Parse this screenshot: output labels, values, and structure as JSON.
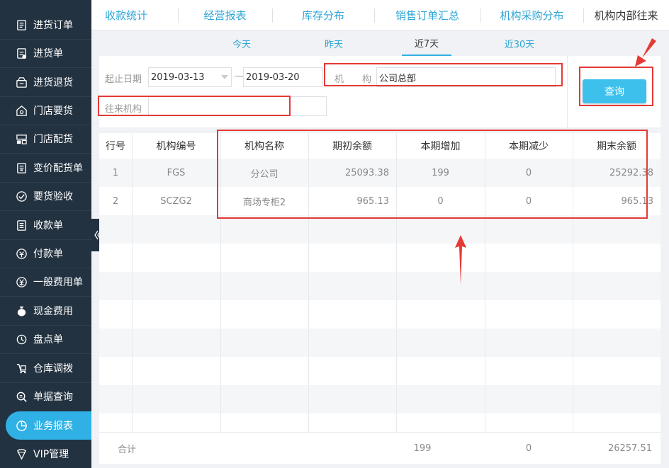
{
  "sidebar": {
    "items": [
      {
        "label": "进货订单",
        "icon": "purchase-order-icon"
      },
      {
        "label": "进货单",
        "icon": "purchase-icon"
      },
      {
        "label": "进货退货",
        "icon": "purchase-return-icon"
      },
      {
        "label": "门店要货",
        "icon": "store-request-icon"
      },
      {
        "label": "门店配货",
        "icon": "store-distribution-icon"
      },
      {
        "label": "变价配货单",
        "icon": "price-change-icon"
      },
      {
        "label": "要货验收",
        "icon": "request-check-icon"
      },
      {
        "label": "收款单",
        "icon": "receipt-icon"
      },
      {
        "label": "付款单",
        "icon": "payment-icon"
      },
      {
        "label": "一般费用单",
        "icon": "yen-icon"
      },
      {
        "label": "现金费用",
        "icon": "cash-bag-icon"
      },
      {
        "label": "盘点单",
        "icon": "inventory-count-icon"
      },
      {
        "label": "仓库调拨",
        "icon": "warehouse-transfer-icon"
      },
      {
        "label": "单据查询",
        "icon": "document-search-icon"
      },
      {
        "label": "业务报表",
        "icon": "pie-chart-icon"
      },
      {
        "label": "VIP管理",
        "icon": "vip-icon"
      }
    ],
    "active_index": 14
  },
  "tabs": [
    {
      "label": "收款统计"
    },
    {
      "label": "经营报表"
    },
    {
      "label": "库存分布"
    },
    {
      "label": "销售订单汇总"
    },
    {
      "label": "机构采购分布"
    },
    {
      "label": "机构内部往来"
    }
  ],
  "periods": [
    {
      "label": "今天"
    },
    {
      "label": "昨天"
    },
    {
      "label": "近7天"
    },
    {
      "label": "近30天"
    }
  ],
  "filters": {
    "date_label": "起止日期",
    "date_start": "2019-03-13",
    "date_sep": "—",
    "date_end": "2019-03-20",
    "org_label": "机　　构",
    "org_value": "公司总部",
    "partner_label": "往来机构",
    "partner_value": ""
  },
  "query_button": "查询",
  "table": {
    "headers": [
      "行号",
      "机构编号",
      "机构名称",
      "期初余额",
      "本期增加",
      "本期减少",
      "期末余额"
    ],
    "rows": [
      [
        "1",
        "FGS",
        "分公司",
        "25093.38",
        "199",
        "0",
        "25292.38"
      ],
      [
        "2",
        "SCZG2",
        "商场专柜2",
        "965.13",
        "0",
        "0",
        "965.13"
      ]
    ]
  },
  "footer": {
    "label": "合计",
    "increase": "199",
    "decrease": "0",
    "ending": "26257.51"
  },
  "colors": {
    "sidebar_bg": "#233240",
    "accent": "#2fb1e5",
    "button": "#3dc1ec",
    "annotation": "#e53935"
  }
}
